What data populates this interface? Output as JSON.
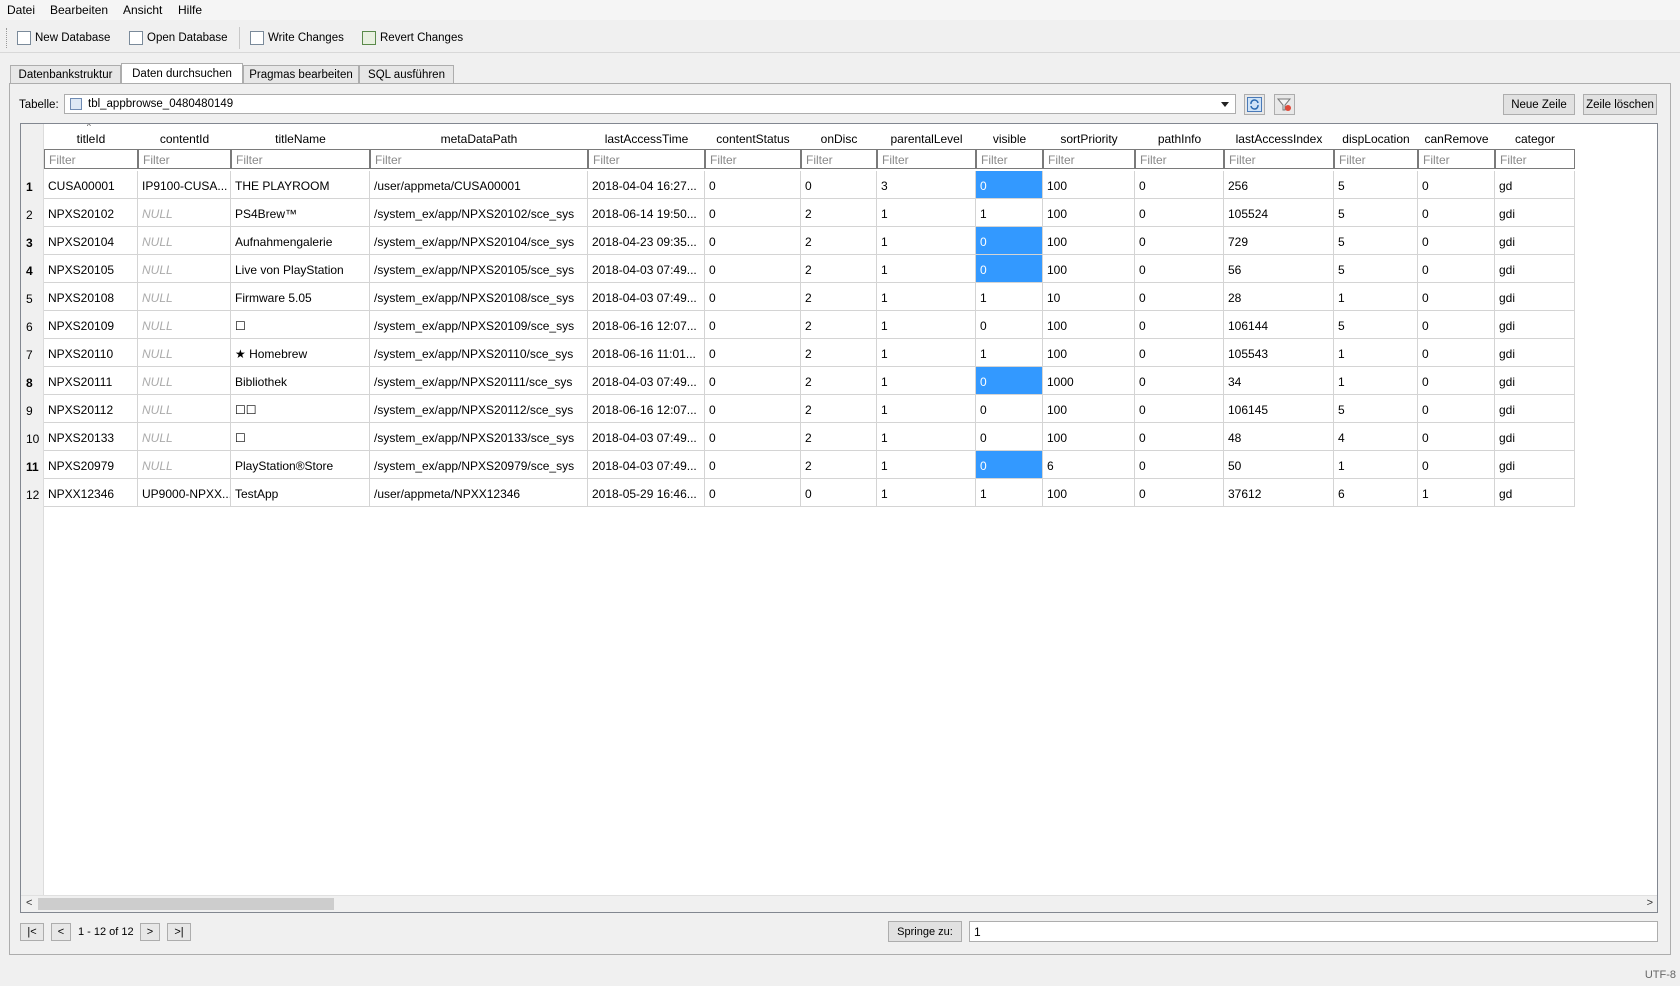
{
  "menu": [
    "Datei",
    "Bearbeiten",
    "Ansicht",
    "Hilfe"
  ],
  "toolbar": {
    "new_db": "New Database",
    "open_db": "Open Database",
    "write": "Write Changes",
    "revert": "Revert Changes"
  },
  "tabs": [
    "Datenbankstruktur",
    "Daten durchsuchen",
    "Pragmas bearbeiten",
    "SQL ausführen"
  ],
  "active_tab": "Daten durchsuchen",
  "table_label": "Tabelle:",
  "table_name": "tbl_appbrowse_0480480149",
  "buttons": {
    "new_row": "Neue Zeile",
    "delete_row": "Zeile löschen"
  },
  "columns": [
    "titleId",
    "contentId",
    "titleName",
    "metaDataPath",
    "lastAccessTime",
    "contentStatus",
    "onDisc",
    "parentalLevel",
    "visible",
    "sortPriority",
    "pathInfo",
    "lastAccessIndex",
    "dispLocation",
    "canRemove",
    "categor"
  ],
  "filter_placeholder": "Filter",
  "rows": [
    {
      "n": "1",
      "bold": true,
      "cells": [
        "CUSA00001",
        "IP9100-CUSA...",
        "THE PLAYROOM",
        "/user/appmeta/CUSA00001",
        "2018-04-04 16:27...",
        "0",
        "0",
        "3",
        "0",
        "100",
        "0",
        "256",
        "5",
        "0",
        "gd"
      ]
    },
    {
      "n": "2",
      "bold": false,
      "cells": [
        "NPXS20102",
        "NULL",
        "PS4Brew™",
        "/system_ex/app/NPXS20102/sce_sys",
        "2018-06-14 19:50...",
        "0",
        "2",
        "1",
        "1",
        "100",
        "0",
        "105524",
        "5",
        "0",
        "gdi"
      ]
    },
    {
      "n": "3",
      "bold": true,
      "cells": [
        "NPXS20104",
        "NULL",
        "Aufnahmengalerie",
        "/system_ex/app/NPXS20104/sce_sys",
        "2018-04-23 09:35...",
        "0",
        "2",
        "1",
        "0",
        "100",
        "0",
        "729",
        "5",
        "0",
        "gdi"
      ]
    },
    {
      "n": "4",
      "bold": true,
      "cells": [
        "NPXS20105",
        "NULL",
        "Live von PlayStation",
        "/system_ex/app/NPXS20105/sce_sys",
        "2018-04-03 07:49...",
        "0",
        "2",
        "1",
        "0",
        "100",
        "0",
        "56",
        "5",
        "0",
        "gdi"
      ]
    },
    {
      "n": "5",
      "bold": false,
      "cells": [
        "NPXS20108",
        "NULL",
        "Firmware 5.05",
        "/system_ex/app/NPXS20108/sce_sys",
        "2018-04-03 07:49...",
        "0",
        "2",
        "1",
        "1",
        "10",
        "0",
        "28",
        "1",
        "0",
        "gdi"
      ]
    },
    {
      "n": "6",
      "bold": false,
      "cells": [
        "NPXS20109",
        "NULL",
        "☐",
        "/system_ex/app/NPXS20109/sce_sys",
        "2018-06-16 12:07...",
        "0",
        "2",
        "1",
        "0",
        "100",
        "0",
        "106144",
        "5",
        "0",
        "gdi"
      ]
    },
    {
      "n": "7",
      "bold": false,
      "cells": [
        "NPXS20110",
        "NULL",
        "★ Homebrew",
        "/system_ex/app/NPXS20110/sce_sys",
        "2018-06-16 11:01...",
        "0",
        "2",
        "1",
        "1",
        "100",
        "0",
        "105543",
        "1",
        "0",
        "gdi"
      ]
    },
    {
      "n": "8",
      "bold": true,
      "cells": [
        "NPXS20111",
        "NULL",
        "Bibliothek",
        "/system_ex/app/NPXS20111/sce_sys",
        "2018-04-03 07:49...",
        "0",
        "2",
        "1",
        "0",
        "1000",
        "0",
        "34",
        "1",
        "0",
        "gdi"
      ]
    },
    {
      "n": "9",
      "bold": false,
      "cells": [
        "NPXS20112",
        "NULL",
        "☐☐",
        "/system_ex/app/NPXS20112/sce_sys",
        "2018-06-16 12:07...",
        "0",
        "2",
        "1",
        "0",
        "100",
        "0",
        "106145",
        "5",
        "0",
        "gdi"
      ]
    },
    {
      "n": "10",
      "bold": false,
      "cells": [
        "NPXS20133",
        "NULL",
        "☐",
        "/system_ex/app/NPXS20133/sce_sys",
        "2018-04-03 07:49...",
        "0",
        "2",
        "1",
        "0",
        "100",
        "0",
        "48",
        "4",
        "0",
        "gdi"
      ]
    },
    {
      "n": "11",
      "bold": true,
      "cells": [
        "NPXS20979",
        "NULL",
        "PlayStation®Store",
        "/system_ex/app/NPXS20979/sce_sys",
        "2018-04-03 07:49...",
        "0",
        "2",
        "1",
        "0",
        "6",
        "0",
        "50",
        "1",
        "0",
        "gdi"
      ]
    },
    {
      "n": "12",
      "bold": false,
      "cells": [
        "NPXX12346",
        "UP9000-NPXX...",
        "TestApp",
        "/user/appmeta/NPXX12346",
        "2018-05-29 16:46...",
        "0",
        "0",
        "1",
        "1",
        "100",
        "0",
        "37612",
        "6",
        "1",
        "gd"
      ]
    }
  ],
  "selected_cells_rows": [
    "1",
    "3",
    "4",
    "8",
    "11"
  ],
  "selection_color": "#3399ff",
  "nav": {
    "first": "|<",
    "prev": "<",
    "range": "1 - 12 of 12",
    "next": ">",
    "last": ">|"
  },
  "goto_label": "Springe zu:",
  "goto_value": "1",
  "encoding": "UTF-8"
}
